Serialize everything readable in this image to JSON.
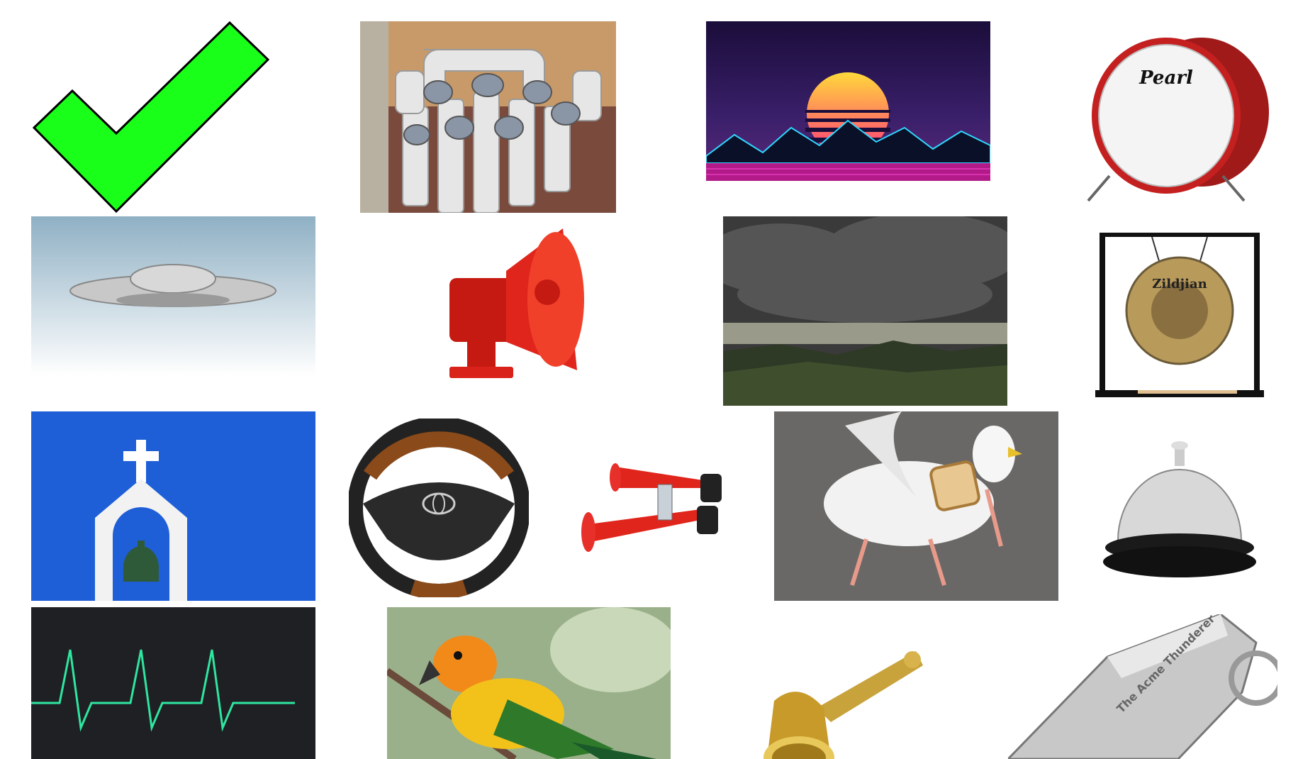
{
  "soundboard": {
    "tiles": [
      {
        "icon": "checkmark-icon"
      },
      {
        "icon": "pvc-pipe-instrument-icon"
      },
      {
        "icon": "synthwave-sunset-icon"
      },
      {
        "icon": "bass-drum-icon",
        "brand_text": "Pearl"
      },
      {
        "icon": "ufo-icon"
      },
      {
        "icon": "siren-horn-icon"
      },
      {
        "icon": "storm-clouds-icon"
      },
      {
        "icon": "gong-icon",
        "brand_text": "Zildjian"
      },
      {
        "icon": "church-bell-icon"
      },
      {
        "icon": "steering-wheel-icon"
      },
      {
        "icon": "air-horn-icon"
      },
      {
        "icon": "seagull-with-bread-icon"
      },
      {
        "icon": "service-bell-icon"
      },
      {
        "icon": "heartbeat-monitor-icon"
      },
      {
        "icon": "parrot-icon"
      },
      {
        "icon": "hand-bell-icon"
      },
      {
        "icon": "whistle-icon",
        "brand_text": "The Acme Thunderer"
      }
    ]
  },
  "colors": {
    "background": "#ffffff",
    "check_green": "#1aff1a",
    "sky_blue": "#1e5fd8",
    "siren_red": "#e0261c",
    "monitor_line": "#2ee6a0"
  }
}
